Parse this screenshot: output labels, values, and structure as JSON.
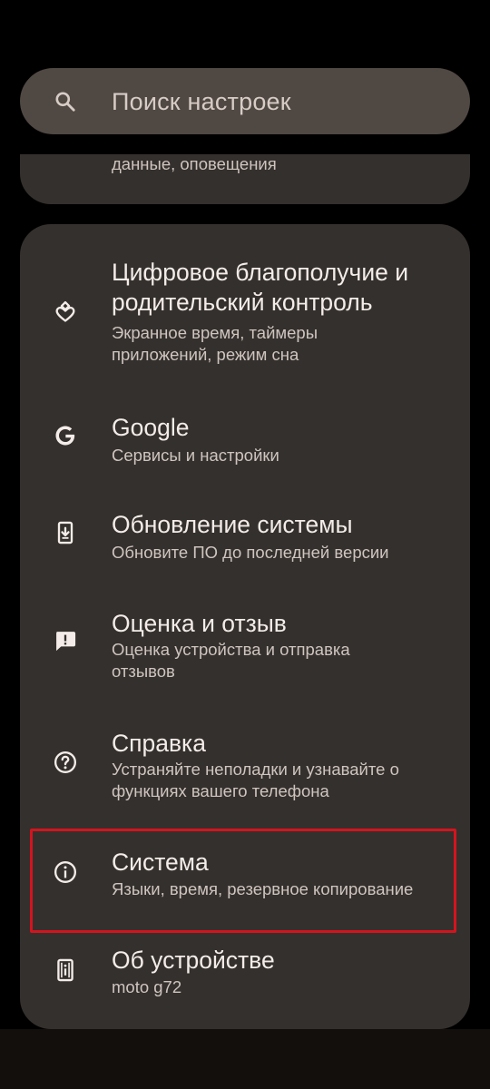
{
  "search": {
    "placeholder": "Поиск настроек"
  },
  "partial_item": {
    "subtitle": "данные, оповещения"
  },
  "items": [
    {
      "title_line1": "Цифровое благополучие и",
      "title_line2": "родительский контроль",
      "subtitle_line1": "Экранное время, таймеры",
      "subtitle_line2": "приложений, режим сна",
      "icon": "digital-wellbeing-icon"
    },
    {
      "title": "Google",
      "subtitle": "Сервисы и настройки",
      "icon": "google-icon"
    },
    {
      "title": "Обновление системы",
      "subtitle": "Обновите ПО до последней версии",
      "icon": "system-update-icon"
    },
    {
      "title": "Оценка и отзыв",
      "subtitle_line1": "Оценка устройства и отправка",
      "subtitle_line2": "отзывов",
      "icon": "feedback-icon"
    },
    {
      "title": "Справка",
      "subtitle_line1": "Устраняйте неполадки и узнавайте о",
      "subtitle_line2": "функциях вашего телефона",
      "icon": "help-icon"
    },
    {
      "title": "Система",
      "subtitle": "Языки, время, резервное копирование",
      "icon": "info-icon",
      "highlighted": true
    },
    {
      "title": "Об устройстве",
      "subtitle": "moto g72",
      "icon": "phone-info-icon"
    }
  ],
  "colors": {
    "background": "#000000",
    "card": "#34302d",
    "search_bar": "#504843",
    "title_text": "#f3ece8",
    "subtitle_text": "#cfc5bf",
    "highlight": "#d3141e"
  }
}
